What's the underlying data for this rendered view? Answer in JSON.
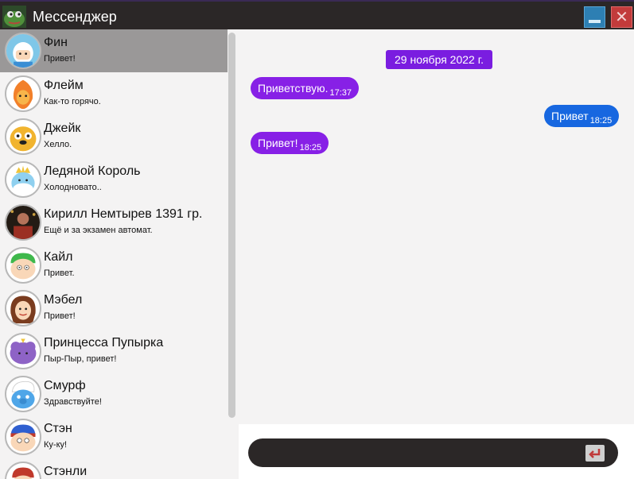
{
  "app": {
    "title": "Мессенджер"
  },
  "contacts": [
    {
      "name": "Фин",
      "last": "Привет!",
      "avatar": "finn-avatar",
      "active": true
    },
    {
      "name": "Флейм",
      "last": "Как-то горячо.",
      "avatar": "flame-princess-avatar"
    },
    {
      "name": "Джейк",
      "last": "Хелло.",
      "avatar": "jake-avatar"
    },
    {
      "name": "Ледяной Король",
      "last": "Холодновато..",
      "avatar": "ice-king-avatar"
    },
    {
      "name": "Кирилл Немтырев 1391 гр.",
      "last": "Ещё и за экзамен автомат.",
      "avatar": "photo-avatar"
    },
    {
      "name": "Кайл",
      "last": "Привет.",
      "avatar": "kyle-avatar"
    },
    {
      "name": "Мэбел",
      "last": "Привет!",
      "avatar": "mabel-avatar"
    },
    {
      "name": "Принцесса Пупырка",
      "last": "Пыр-Пыр, привет!",
      "avatar": "lumpy-princess-avatar"
    },
    {
      "name": "Смурф",
      "last": "Здравствуйте!",
      "avatar": "smurf-avatar"
    },
    {
      "name": "Стэн",
      "last": "Ку-ку!",
      "avatar": "stan-avatar"
    },
    {
      "name": "Стэнли",
      "last": "",
      "avatar": "stanley-avatar"
    }
  ],
  "chat": {
    "date": "29 ноября 2022 г.",
    "messages": [
      {
        "text": "Приветствую.",
        "time": "17:37",
        "direction": "in"
      },
      {
        "text": "Привет",
        "time": "18:25",
        "direction": "out"
      },
      {
        "text": "Привет!",
        "time": "18:25",
        "direction": "in"
      }
    ]
  },
  "input": {
    "value": "",
    "placeholder": ""
  },
  "colors": {
    "incoming": "#8720e6",
    "outgoing": "#1767e0",
    "date": "#7a1de0",
    "titlebar": "#2b2727"
  }
}
